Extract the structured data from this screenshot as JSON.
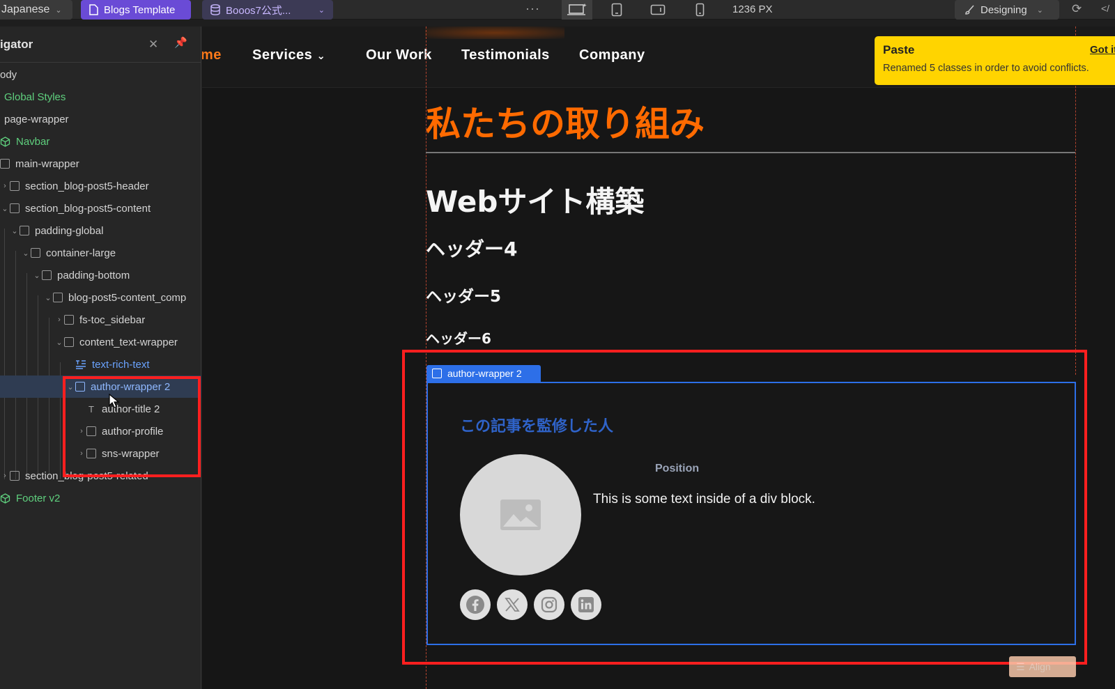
{
  "topbar": {
    "language": "Japanese",
    "template": "Blogs Template",
    "cms": "Booos7公式...",
    "more": "···",
    "width": "1236 PX",
    "mode": "Designing"
  },
  "navigator": {
    "title": "igator",
    "items": [
      {
        "label": "ody"
      },
      {
        "label": "Global Styles"
      },
      {
        "label": "page-wrapper"
      },
      {
        "label": "Navbar"
      },
      {
        "label": "main-wrapper"
      },
      {
        "label": "section_blog-post5-header"
      },
      {
        "label": "section_blog-post5-content"
      },
      {
        "label": "padding-global"
      },
      {
        "label": "container-large"
      },
      {
        "label": "padding-bottom"
      },
      {
        "label": "blog-post5-content_comp"
      },
      {
        "label": "fs-toc_sidebar"
      },
      {
        "label": "content_text-wrapper"
      },
      {
        "label": "text-rich-text"
      },
      {
        "label": "author-wrapper 2"
      },
      {
        "label": "author-title 2"
      },
      {
        "label": "author-profile"
      },
      {
        "label": "sns-wrapper"
      },
      {
        "label": "section_blog-post5-related"
      },
      {
        "label": "Footer v2"
      }
    ]
  },
  "site_nav": {
    "partial_link": "me",
    "services": "Services",
    "our_work": "Our Work",
    "testimonials": "Testimonials",
    "company": "Company"
  },
  "content": {
    "h1": "私たちの取り組み",
    "h2": "Webサイト構築",
    "h4": "ヘッダー4",
    "h5": "ヘッダー5",
    "h6": "ヘッダー6"
  },
  "author": {
    "tag": "author-wrapper 2",
    "title": "この記事を監修した人",
    "position": "Position",
    "text": "This is some text inside of a div block."
  },
  "align_button": "Align",
  "toast": {
    "title": "Paste",
    "message": "Renamed 5 classes in order to avoid conflicts.",
    "action": "Got it"
  },
  "colors": {
    "accent_orange": "#ff6a00",
    "selection_blue": "#2d6fe8",
    "highlight_red": "#ff1f1f",
    "toast_yellow": "#ffd400",
    "template_purple": "#6a4bd6"
  }
}
